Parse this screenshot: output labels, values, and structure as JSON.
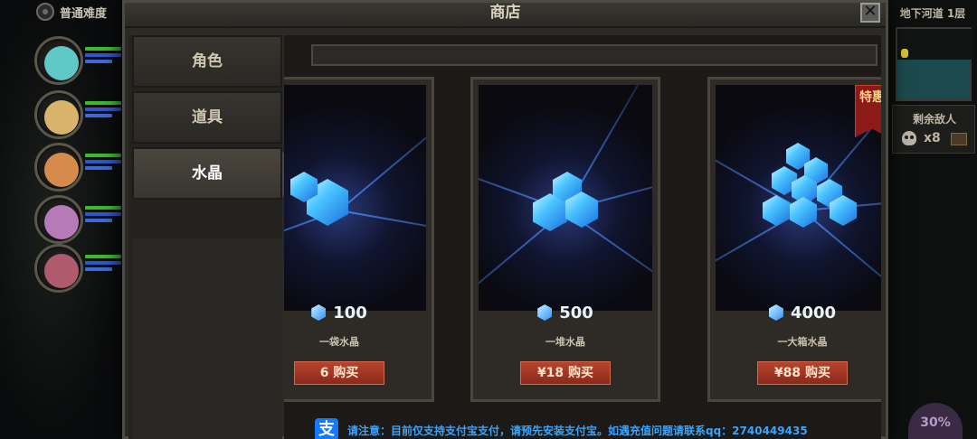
{
  "hud": {
    "difficulty_label": "普通难度",
    "map_title": "地下河道 1层",
    "enemy_label": "剩余敌人",
    "enemy_count": "x8",
    "skill_percent": "30%",
    "heroes": [
      {
        "portrait_color": "#5fc9c7"
      },
      {
        "portrait_color": "#d7b46a"
      },
      {
        "portrait_color": "#d68a4c"
      },
      {
        "portrait_color": "#b77ab8"
      },
      {
        "portrait_color": "#b05a6e"
      }
    ]
  },
  "shop": {
    "title": "商店",
    "close_label": "✕",
    "tabs": [
      {
        "label": "角色",
        "active": false
      },
      {
        "label": "道具",
        "active": false
      },
      {
        "label": "水晶",
        "active": true
      }
    ],
    "items": [
      {
        "amount": "100",
        "name": "一袋水晶",
        "buy_label": "6   购买",
        "tag": ""
      },
      {
        "amount": "500",
        "name": "一堆水晶",
        "buy_label": "¥18   购买",
        "tag": ""
      },
      {
        "amount": "4000",
        "name": "一大箱水晶",
        "buy_label": "¥88   购买",
        "tag": "特惠"
      }
    ],
    "notice": {
      "icon": "支",
      "text": "请注意：目前仅支持支付宝支付，请预先安装支付宝。如遇充值问题请联系qq：2740449435"
    }
  },
  "colors": {
    "gem": "#4ac4ff",
    "buy_button": "#b8432d",
    "notice_text": "#3aa3ff",
    "alipay": "#1677ff"
  }
}
